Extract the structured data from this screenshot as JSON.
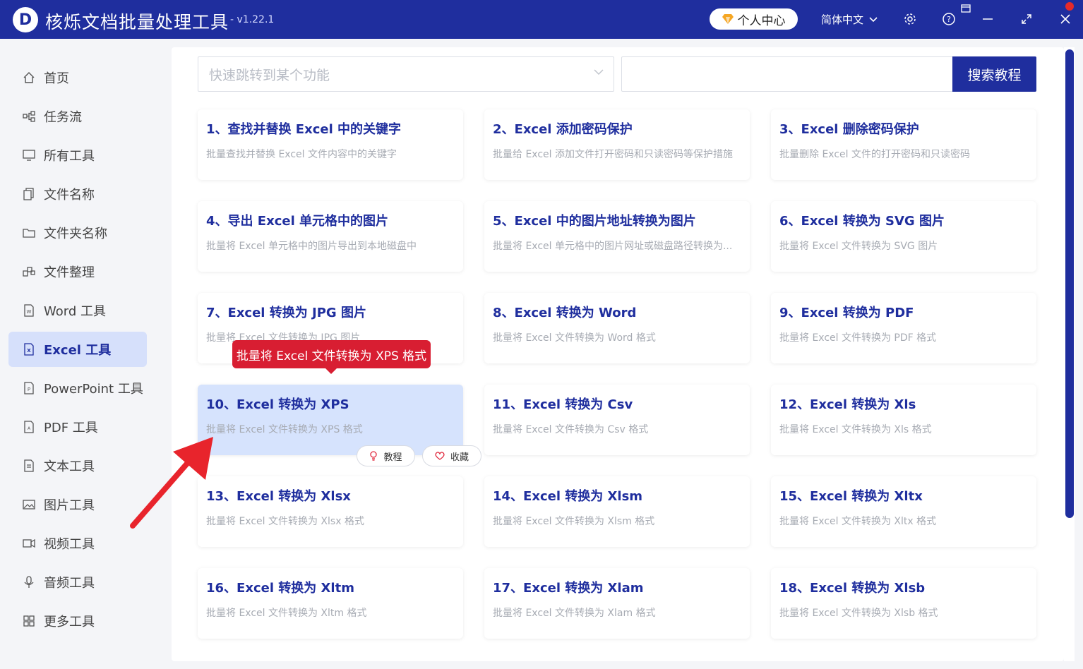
{
  "app": {
    "title": "核烁文档批量处理工具",
    "version": "- v1.22.1",
    "logo_letter": "D",
    "user_center": "个人中心",
    "language": "简体中文"
  },
  "sidebar": {
    "items": [
      {
        "label": "首页",
        "icon": "home-icon"
      },
      {
        "label": "任务流",
        "icon": "workflow-icon"
      },
      {
        "label": "所有工具",
        "icon": "monitor-icon"
      },
      {
        "label": "文件名称",
        "icon": "file-copy-icon"
      },
      {
        "label": "文件夹名称",
        "icon": "folder-icon"
      },
      {
        "label": "文件整理",
        "icon": "organize-icon"
      },
      {
        "label": "Word 工具",
        "icon": "word-file-icon"
      },
      {
        "label": "Excel 工具",
        "icon": "excel-file-icon",
        "active": true
      },
      {
        "label": "PowerPoint 工具",
        "icon": "ppt-file-icon"
      },
      {
        "label": "PDF 工具",
        "icon": "pdf-file-icon"
      },
      {
        "label": "文本工具",
        "icon": "text-file-icon"
      },
      {
        "label": "图片工具",
        "icon": "image-icon"
      },
      {
        "label": "视频工具",
        "icon": "video-icon"
      },
      {
        "label": "音频工具",
        "icon": "microphone-icon"
      },
      {
        "label": "更多工具",
        "icon": "grid-icon"
      }
    ]
  },
  "search": {
    "placeholder": "快速跳转到某个功能",
    "button": "搜索教程"
  },
  "cards": [
    {
      "title": "1、查找并替换 Excel 中的关键字",
      "desc": "批量查找并替换 Excel 文件内容中的关键字"
    },
    {
      "title": "2、Excel 添加密码保护",
      "desc": "批量给 Excel 添加文件打开密码和只读密码等保护措施"
    },
    {
      "title": "3、Excel 删除密码保护",
      "desc": "批量删除 Excel 文件的打开密码和只读密码"
    },
    {
      "title": "4、导出 Excel 单元格中的图片",
      "desc": "批量将 Excel 单元格中的图片导出到本地磁盘中"
    },
    {
      "title": "5、Excel 中的图片地址转换为图片",
      "desc": "批量将 Excel 单元格中的图片网址或磁盘路径转换为..."
    },
    {
      "title": "6、Excel 转换为 SVG 图片",
      "desc": "批量将 Excel 文件转换为 SVG 图片"
    },
    {
      "title": "7、Excel 转换为 JPG 图片",
      "desc": "批量将 Excel 文件转换为 JPG 图片"
    },
    {
      "title": "8、Excel 转换为 Word",
      "desc": "批量将 Excel 文件转换为 Word 格式"
    },
    {
      "title": "9、Excel 转换为 PDF",
      "desc": "批量将 Excel 文件转换为 PDF 格式"
    },
    {
      "title": "10、Excel 转换为 XPS",
      "desc": "批量将 Excel 文件转换为 XPS 格式",
      "active": true
    },
    {
      "title": "11、Excel 转换为 Csv",
      "desc": "批量将 Excel 文件转换为 Csv 格式"
    },
    {
      "title": "12、Excel 转换为 Xls",
      "desc": "批量将 Excel 文件转换为 Xls 格式"
    },
    {
      "title": "13、Excel 转换为 Xlsx",
      "desc": "批量将 Excel 文件转换为 Xlsx 格式"
    },
    {
      "title": "14、Excel 转换为 Xlsm",
      "desc": "批量将 Excel 文件转换为 Xlsm 格式"
    },
    {
      "title": "15、Excel 转换为 Xltx",
      "desc": "批量将 Excel 文件转换为 Xltx 格式"
    },
    {
      "title": "16、Excel 转换为 Xltm",
      "desc": "批量将 Excel 文件转换为 Xltm 格式"
    },
    {
      "title": "17、Excel 转换为 Xlam",
      "desc": "批量将 Excel 文件转换为 Xlam 格式"
    },
    {
      "title": "18、Excel 转换为 Xlsb",
      "desc": "批量将 Excel 文件转换为 Xlsb 格式"
    }
  ],
  "card_actions": {
    "tutorial": "教程",
    "favorite": "收藏"
  },
  "tooltip": "批量将 Excel 文件转换为 XPS 格式",
  "colors": {
    "brand": "#1f2e9e",
    "active_bg": "#d6e3fd",
    "tooltip": "#d81e32",
    "arrow": "#e8242c"
  }
}
